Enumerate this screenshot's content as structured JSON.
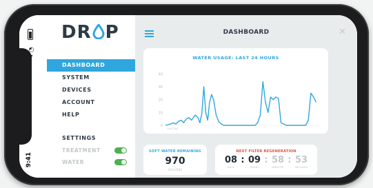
{
  "app": {
    "logo_text_1": "DR",
    "logo_text_2": "P"
  },
  "status_bar": {
    "time": "9:41"
  },
  "sidebar": {
    "items": [
      {
        "label": "DASHBOARD",
        "active": true
      },
      {
        "label": "SYSTEM",
        "active": false
      },
      {
        "label": "DEVICES",
        "active": false
      },
      {
        "label": "ACCOUNT",
        "active": false
      },
      {
        "label": "HELP",
        "active": false
      }
    ],
    "settings_label": "SETTINGS",
    "toggles": [
      {
        "label": "TREATMENT",
        "on": true
      },
      {
        "label": "WATER",
        "on": true
      }
    ]
  },
  "header": {
    "title": "DASHBOARD"
  },
  "usage_card": {
    "title": "WATER USAGE: LAST 24 HOURS"
  },
  "chart_data": {
    "type": "line",
    "title": "WATER USAGE: LAST 24 HOURS",
    "ylabel": "GALLONS",
    "yticks": [
      "0",
      "10",
      "20",
      "30",
      "40"
    ],
    "ylim": [
      0,
      45
    ],
    "xlim": [
      0,
      24
    ],
    "x": [
      0,
      0.8,
      1.2,
      1.6,
      2.0,
      2.4,
      2.8,
      3.2,
      3.6,
      4.0,
      4.6,
      5.0,
      5.3,
      5.6,
      5.9,
      6.2,
      6.5,
      6.8,
      7.1,
      7.4,
      7.8,
      8.2,
      8.6,
      9.0,
      9.4,
      9.8,
      10.2,
      11,
      12,
      13,
      13.8,
      14.2,
      14.6,
      15.0,
      15.4,
      15.8,
      16.2,
      16.6,
      17.0,
      17.4,
      17.8,
      18.2,
      18.6,
      19.0,
      19.4,
      19.8,
      20.2,
      21,
      21.6,
      22.0,
      22.4,
      22.8,
      23.2
    ],
    "values": [
      0,
      1,
      2,
      1,
      3,
      4,
      2,
      5,
      6,
      4,
      8,
      6,
      2,
      9,
      30,
      10,
      4,
      18,
      24,
      20,
      8,
      3,
      1,
      0,
      0,
      0,
      0,
      0,
      0,
      0,
      0,
      2,
      8,
      34,
      18,
      10,
      22,
      20,
      22,
      21,
      2,
      1,
      0,
      0,
      0,
      0,
      0,
      0,
      0,
      4,
      25,
      22,
      18
    ],
    "color": "#2fa6dd"
  },
  "soft_water": {
    "title": "SOFT WATER REMAINING",
    "value": "970",
    "unit": "GALLONS"
  },
  "regeneration": {
    "title": "NEXT FILTER REGENERATION",
    "days": "08",
    "hours": "09",
    "minutes": "58",
    "seconds": "53",
    "days_label": "DAYS",
    "hours_label": "HOURS",
    "minutes_label": "MINUTES",
    "seconds_label": "SECONDS",
    "separator": ":"
  },
  "colors": {
    "accent": "#2fa6dd",
    "alert": "#e24b3b",
    "toggle_on": "#4caf50",
    "text_dark": "#2e3a45"
  }
}
